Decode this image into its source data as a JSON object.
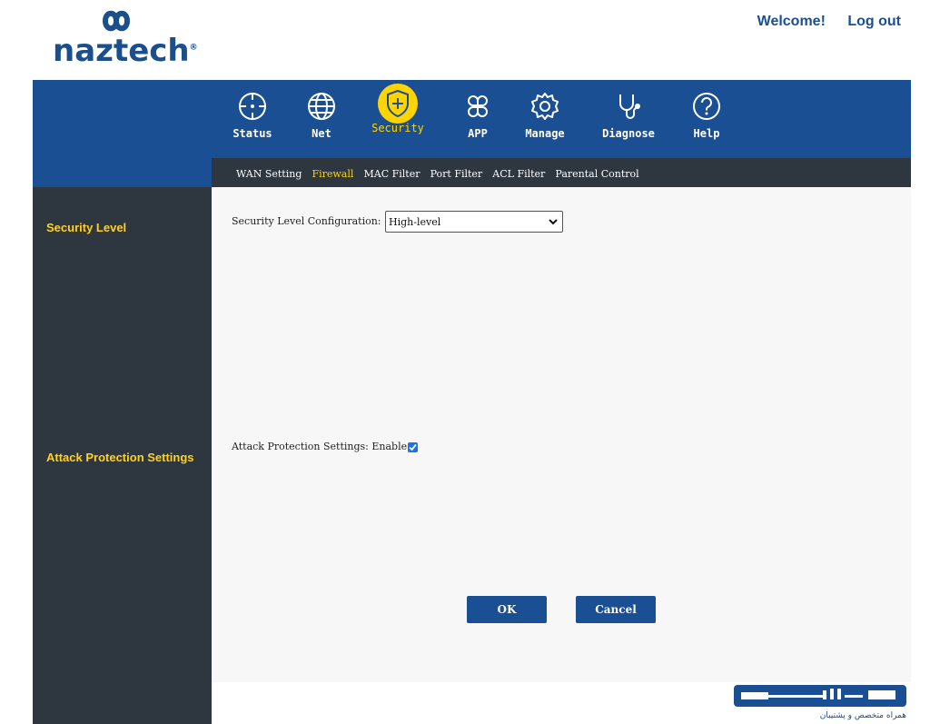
{
  "header": {
    "logo_text": "naztech",
    "logo_reg": "®",
    "welcome": "Welcome!",
    "logout": "Log out"
  },
  "nav": {
    "items": [
      {
        "label": "Status",
        "icon": "crosshair-icon"
      },
      {
        "label": "Net",
        "icon": "globe-icon"
      },
      {
        "label": "Security",
        "icon": "shield-plus-icon",
        "active": true
      },
      {
        "label": "APP",
        "icon": "command-icon"
      },
      {
        "label": "Manage",
        "icon": "gear-icon"
      },
      {
        "label": "Diagnose",
        "icon": "stethoscope-icon"
      },
      {
        "label": "Help",
        "icon": "help-circle-icon"
      }
    ]
  },
  "subnav": {
    "items": [
      "WAN Setting",
      "Firewall",
      "MAC Filter",
      "Port Filter",
      "ACL Filter",
      "Parental Control"
    ],
    "active": "Firewall"
  },
  "sidebar": {
    "items": [
      "Security Level",
      "Attack Protection Settings"
    ]
  },
  "form": {
    "security_level_label": "Security Level Configuration:",
    "security_level_value": "High-level",
    "attack_protection_label": "Attack Protection Settings: Enable",
    "attack_protection_enabled": true,
    "ok": "OK",
    "cancel": "Cancel"
  },
  "footer": {
    "tagline": "همراه متخصص و پشتیبان"
  },
  "colors": {
    "brand_blue": "#1b4f93",
    "dark": "#2e3640",
    "accent_yellow": "#ffd400"
  }
}
